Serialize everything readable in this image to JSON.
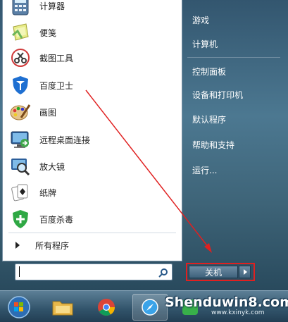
{
  "left_items": [
    {
      "label": "计算器",
      "icon": "calculator-icon"
    },
    {
      "label": "便笺",
      "icon": "sticky-notes-icon"
    },
    {
      "label": "截图工具",
      "icon": "snipping-tool-icon"
    },
    {
      "label": "百度卫士",
      "icon": "baidu-guard-icon"
    },
    {
      "label": "画图",
      "icon": "paint-icon"
    },
    {
      "label": "远程桌面连接",
      "icon": "remote-desktop-icon"
    },
    {
      "label": "放大镜",
      "icon": "magnifier-icon"
    },
    {
      "label": "纸牌",
      "icon": "solitaire-icon"
    },
    {
      "label": "百度杀毒",
      "icon": "baidu-antivirus-icon"
    }
  ],
  "all_programs": "所有程序",
  "search": {
    "value": "",
    "icon": "search-icon"
  },
  "right_items": [
    "游戏",
    "计算机",
    "控制面板",
    "设备和打印机",
    "默认程序",
    "帮助和支持",
    "运行..."
  ],
  "shutdown": {
    "label": "关机",
    "options_icon": "chevron-right-icon"
  },
  "taskbar": {
    "items": [
      "start-orb-icon",
      "file-explorer-icon",
      "chrome-icon",
      "task-app-icon"
    ]
  },
  "watermark": {
    "main": "Shenduwin8.com",
    "sub": "www.kxinyk.com"
  },
  "colors": {
    "annotation_red": "#e02020",
    "menu_bg": "#3e6478"
  }
}
